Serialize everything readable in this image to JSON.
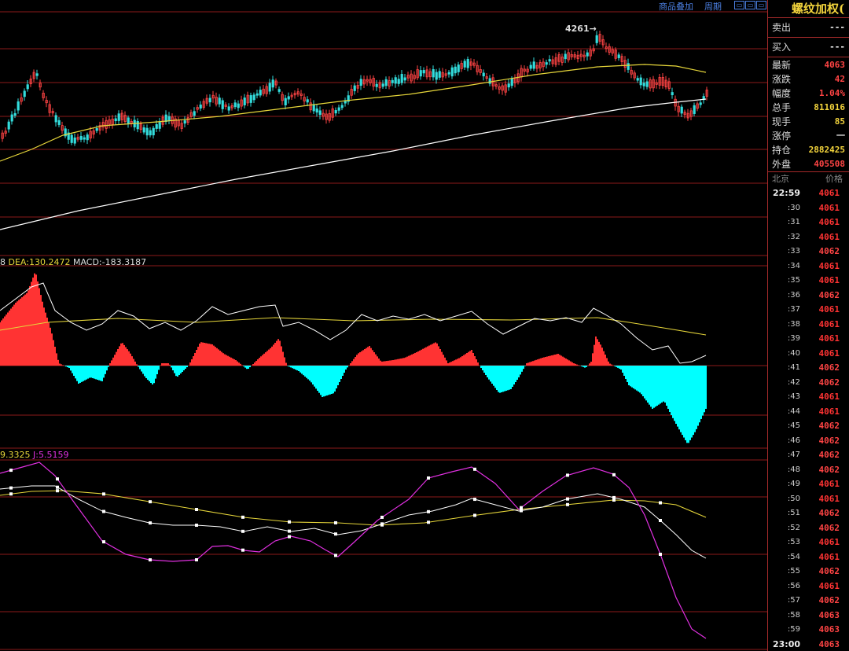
{
  "top_links": {
    "overlay": "商品叠加",
    "period": "周期"
  },
  "window_buttons": [
    "▭",
    "▭",
    "▭"
  ],
  "main_chart": {
    "high_marker": "4261",
    "colors": {
      "candle_up": "#ff4444",
      "candle_down": "#33dddd",
      "ma_mid": "#e6d63a",
      "ma_long": "#ffffff",
      "grid": "#8b1a1a"
    }
  },
  "macd": {
    "labels": {
      "prefix": "8",
      "dea": "DEA:130.2472",
      "macd": "MACD:-183.3187"
    },
    "colors": {
      "pos": "#ff3333",
      "neg": "#00ffff",
      "dea": "#e6d63a",
      "dif": "#ffffff"
    }
  },
  "kdj": {
    "labels": {
      "prefix": "9.3325",
      "j": "J:5.5159"
    },
    "colors": {
      "k": "#ffffff",
      "d": "#e6d63a",
      "j": "#e030e0"
    }
  },
  "sidebar": {
    "title": "螺纹加权(",
    "bid_ask": [
      {
        "label": "卖出",
        "value": "---"
      },
      {
        "label": "买入",
        "value": "---"
      }
    ],
    "stats": [
      {
        "label": "最新",
        "value": "4063",
        "color": "#ff4444"
      },
      {
        "label": "涨跌",
        "value": "42",
        "color": "#ff4444"
      },
      {
        "label": "幅度",
        "value": "1.04%",
        "color": "#ff4444"
      },
      {
        "label": "总手",
        "value": "811016",
        "color": "#f3d43c"
      },
      {
        "label": "现手",
        "value": "85",
        "color": "#f3d43c"
      },
      {
        "label": "涨停",
        "value": "一",
        "color": "#dddddd"
      },
      {
        "label": "持仓",
        "value": "2882425",
        "color": "#f3d43c"
      },
      {
        "label": "外盘",
        "value": "405508",
        "color": "#ff4444"
      }
    ],
    "ticks_header": {
      "time": "北京",
      "price": "价格"
    },
    "ticks": [
      {
        "time": "22:59",
        "price": "4061"
      },
      {
        "time": ":30",
        "price": "4061"
      },
      {
        "time": ":31",
        "price": "4061"
      },
      {
        "time": ":32",
        "price": "4061"
      },
      {
        "time": ":33",
        "price": "4062"
      },
      {
        "time": ":34",
        "price": "4061"
      },
      {
        "time": ":35",
        "price": "4061"
      },
      {
        "time": ":36",
        "price": "4062"
      },
      {
        "time": ":37",
        "price": "4061"
      },
      {
        "time": ":38",
        "price": "4061"
      },
      {
        "time": ":39",
        "price": "4061"
      },
      {
        "time": ":40",
        "price": "4061"
      },
      {
        "time": ":41",
        "price": "4062"
      },
      {
        "time": ":42",
        "price": "4062"
      },
      {
        "time": ":43",
        "price": "4061"
      },
      {
        "time": ":44",
        "price": "4061"
      },
      {
        "time": ":45",
        "price": "4062"
      },
      {
        "time": ":46",
        "price": "4062"
      },
      {
        "time": ":47",
        "price": "4062"
      },
      {
        "time": ":48",
        "price": "4062"
      },
      {
        "time": ":49",
        "price": "4061"
      },
      {
        "time": ":50",
        "price": "4061"
      },
      {
        "time": ":51",
        "price": "4062"
      },
      {
        "time": ":52",
        "price": "4062"
      },
      {
        "time": ":53",
        "price": "4061"
      },
      {
        "time": ":54",
        "price": "4061"
      },
      {
        "time": ":55",
        "price": "4062"
      },
      {
        "time": ":56",
        "price": "4061"
      },
      {
        "time": ":57",
        "price": "4062"
      },
      {
        "time": ":58",
        "price": "4063"
      },
      {
        "time": ":59",
        "price": "4063"
      },
      {
        "time": "23:00",
        "price": "4063"
      }
    ]
  }
}
